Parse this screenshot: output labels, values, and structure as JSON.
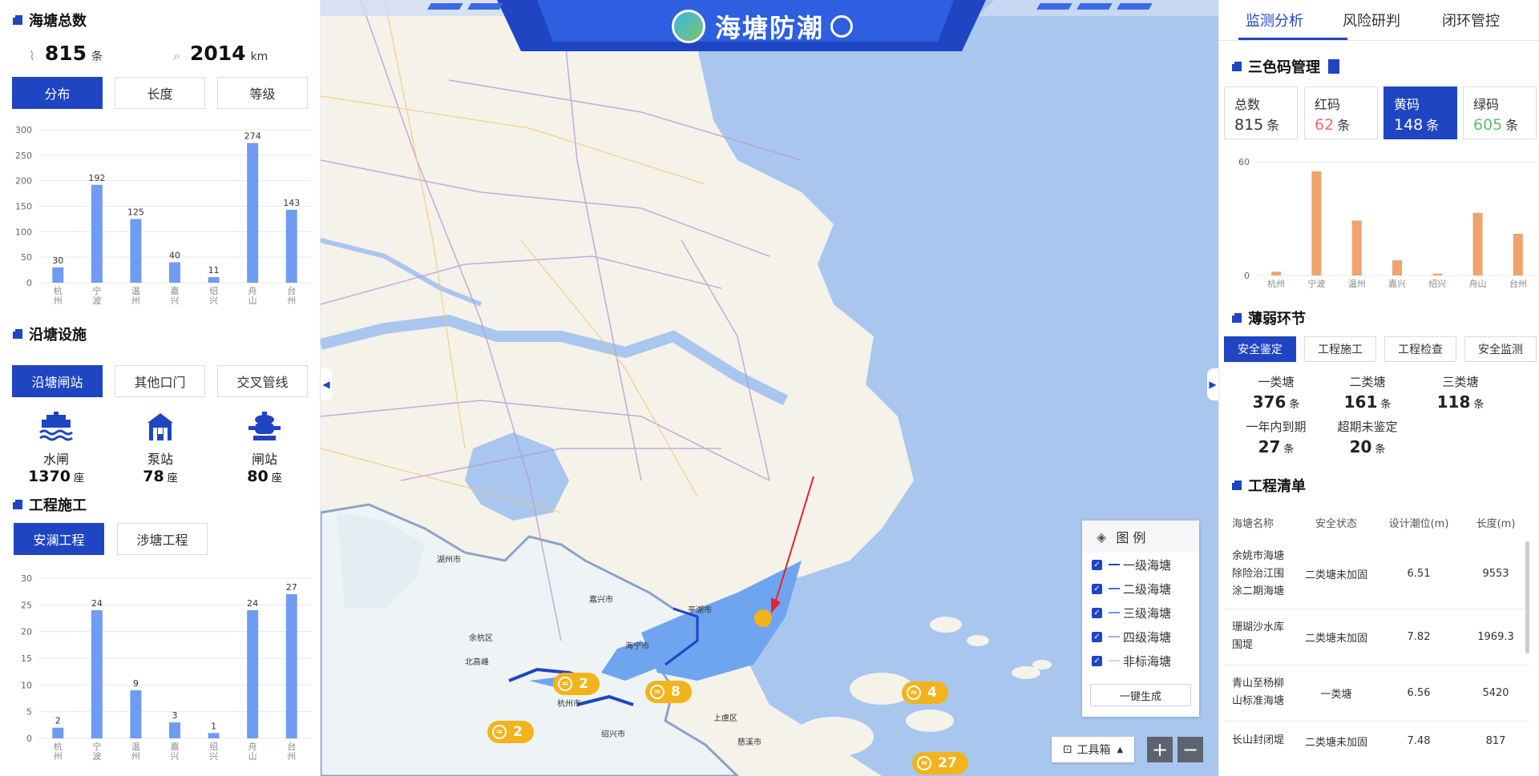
{
  "left": {
    "total": {
      "title": "海塘总数",
      "count": "815",
      "count_unit": "条",
      "length": "2014",
      "length_unit": "km"
    },
    "total_buttons": [
      "分布",
      "长度",
      "等级"
    ],
    "dist_chart": {
      "type": "bar",
      "categories": [
        "杭州",
        "宁波",
        "温州",
        "嘉兴",
        "绍兴",
        "舟山",
        "台州"
      ],
      "values": [
        30,
        192,
        125,
        40,
        11,
        274,
        143
      ],
      "ylim": [
        0,
        300
      ],
      "yticks": [
        0,
        50,
        100,
        150,
        200,
        250,
        300
      ],
      "color": "#6f9cf2"
    },
    "facility": {
      "title": "沿塘设施",
      "buttons": [
        "沿塘闸站",
        "其他口门",
        "交叉管线"
      ],
      "items": [
        {
          "label": "水闸",
          "value": "1370",
          "unit": "座",
          "icon": "sluice-icon"
        },
        {
          "label": "泵站",
          "value": "78",
          "unit": "座",
          "icon": "pump-station-icon"
        },
        {
          "label": "闸站",
          "value": "80",
          "unit": "座",
          "icon": "gate-station-icon"
        }
      ]
    },
    "project": {
      "title": "工程施工",
      "buttons": [
        "安澜工程",
        "涉塘工程"
      ]
    },
    "proj_chart": {
      "type": "bar",
      "categories": [
        "杭州",
        "宁波",
        "温州",
        "嘉兴",
        "绍兴",
        "舟山",
        "台州"
      ],
      "values": [
        2,
        24,
        9,
        3,
        1,
        24,
        27
      ],
      "ylim": [
        0,
        30
      ],
      "yticks": [
        0,
        5,
        10,
        15,
        20,
        25,
        30
      ],
      "color": "#6f9cf2"
    }
  },
  "header": {
    "title": "海塘防潮"
  },
  "map": {
    "legend": {
      "title": "图 例",
      "items": [
        "一级海塘",
        "二级海塘",
        "三级海塘",
        "四级海塘",
        "非标海塘"
      ],
      "generate": "一键生成"
    },
    "toolbox": "工具箱",
    "zoom_in": "+",
    "zoom_out": "−",
    "clusters": [
      {
        "n": "2"
      },
      {
        "n": "8"
      },
      {
        "n": "2"
      },
      {
        "n": "4"
      },
      {
        "n": "27"
      }
    ],
    "labels": [
      "湖州市",
      "嘉兴市",
      "杭州市",
      "绍兴市",
      "平湖市",
      "海宁市",
      "余杭区",
      "北高峰",
      "上虞区",
      "慈溪市"
    ]
  },
  "right": {
    "tabs": [
      "监测分析",
      "风险研判",
      "闭环管控"
    ],
    "colorcode": {
      "title": "三色码管理",
      "cards": [
        {
          "label": "总数",
          "value": "815",
          "unit": "条",
          "color": "#333333"
        },
        {
          "label": "红码",
          "value": "62",
          "unit": "条",
          "color": "#f0696a"
        },
        {
          "label": "黄码",
          "value": "148",
          "unit": "条",
          "color": "#ffffff"
        },
        {
          "label": "绿码",
          "value": "605",
          "unit": "条",
          "color": "#5fbf6a"
        }
      ]
    },
    "yellow_chart": {
      "type": "bar",
      "categories": [
        "杭州",
        "宁波",
        "温州",
        "嘉兴",
        "绍兴",
        "舟山",
        "台州"
      ],
      "values": [
        2,
        55,
        29,
        8,
        1,
        33,
        22
      ],
      "ylim": [
        0,
        60
      ],
      "yticks": [
        0,
        60
      ],
      "color": "#f0a36c"
    },
    "weak": {
      "title": "薄弱环节",
      "buttons": [
        "安全鉴定",
        "工程施工",
        "工程检查",
        "安全监测"
      ],
      "items": [
        {
          "label": "一类塘",
          "value": "376",
          "unit": "条"
        },
        {
          "label": "二类塘",
          "value": "161",
          "unit": "条"
        },
        {
          "label": "三类塘",
          "value": "118",
          "unit": "条"
        },
        {
          "label": "一年内到期",
          "value": "27",
          "unit": "条"
        },
        {
          "label": "超期未鉴定",
          "value": "20",
          "unit": "条"
        }
      ]
    },
    "list": {
      "title": "工程清单",
      "headers": [
        "海塘名称",
        "安全状态",
        "设计潮位(m)",
        "长度(m)"
      ],
      "rows": [
        [
          "余姚市海塘除险治江围涂二期海塘",
          "二类塘未加固",
          "6.51",
          "9553"
        ],
        [
          "珊瑚沙水库围堤",
          "二类塘未加固",
          "7.82",
          "1969.3"
        ],
        [
          "青山至杨柳山标准海塘",
          "一类塘",
          "6.56",
          "5420"
        ],
        [
          "长山封闭堤",
          "二类塘未加固",
          "7.48",
          "817"
        ]
      ]
    }
  }
}
